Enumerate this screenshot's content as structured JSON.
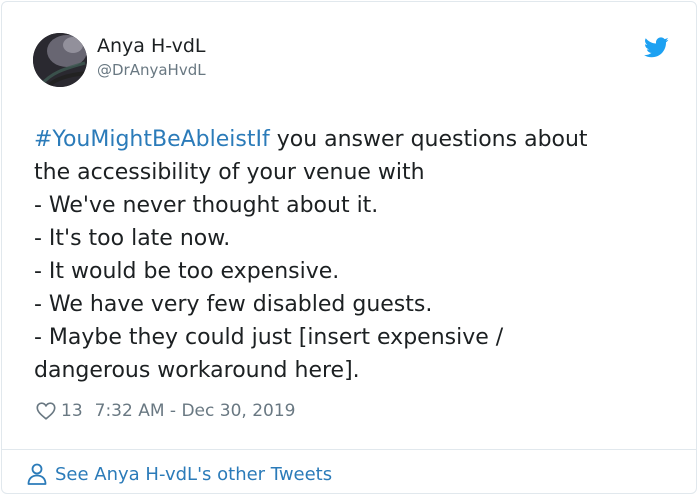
{
  "author": {
    "name": "Anya H-vdL",
    "handle": "@DrAnyaHvdL"
  },
  "tweet": {
    "hashtag": "#YouMightBeAbleistIf",
    "line1_rest": " you answer questions about",
    "line2": "the accessibility of your venue with",
    "line3": "- We've never thought about it.",
    "line4": "- It's too late now.",
    "line5": "- It would be too expensive.",
    "line6": "- We have very few disabled guests.",
    "line7": "- Maybe they could just [insert expensive /",
    "line8": "dangerous workaround here]."
  },
  "meta": {
    "likes": "13",
    "timestamp": "7:32 AM - Dec 30, 2019"
  },
  "footer": {
    "link_text": "See Anya H-vdL's other Tweets"
  },
  "colors": {
    "link": "#2b7bb9",
    "muted": "#697882",
    "text": "#1c2022",
    "twitter_blue": "#1da1f2",
    "border": "#e1e8ed"
  },
  "icons": {
    "brand": "twitter-bird-icon",
    "like": "heart-icon",
    "profile": "person-icon"
  }
}
